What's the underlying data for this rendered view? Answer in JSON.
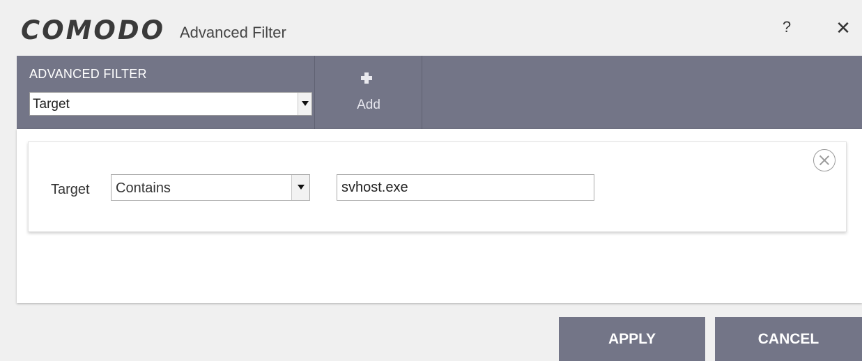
{
  "window": {
    "logo_text": "COMODO",
    "title": "Advanced Filter",
    "help_label": "?",
    "close_label": "✕"
  },
  "toolbar": {
    "filter_label": "ADVANCED FILTER",
    "filter_selected": "Target",
    "add_label": "Add"
  },
  "condition": {
    "field_label": "Target",
    "operator_selected": "Contains",
    "value": "svhost.exe"
  },
  "footer": {
    "apply_label": "APPLY",
    "cancel_label": "CANCEL"
  },
  "colors": {
    "toolbar_bg": "#737587",
    "window_bg": "#f0f0f0",
    "button_bg": "#737587"
  },
  "icons": [
    "plus-icon",
    "remove-circle-icon",
    "chevron-down-icon",
    "close-icon",
    "help-icon"
  ]
}
